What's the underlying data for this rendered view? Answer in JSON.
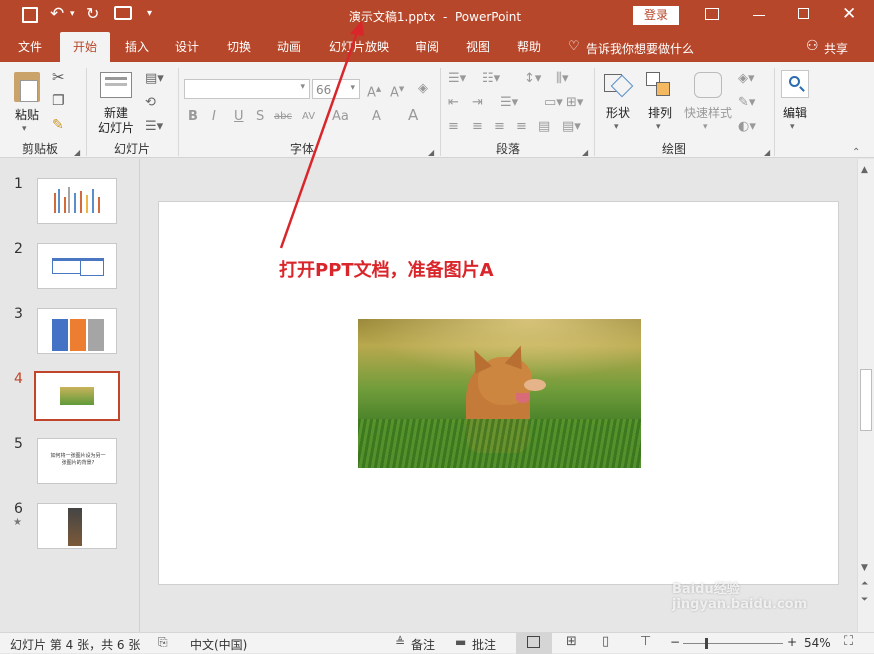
{
  "titlebar": {
    "doc_title": "演示文稿1.pptx  -  PowerPoint",
    "login_button": "登录",
    "quick_access_more": "▾"
  },
  "tabs": [
    {
      "label": "文件"
    },
    {
      "label": "开始"
    },
    {
      "label": "插入"
    },
    {
      "label": "设计"
    },
    {
      "label": "切换"
    },
    {
      "label": "动画"
    },
    {
      "label": "幻灯片放映"
    },
    {
      "label": "审阅"
    },
    {
      "label": "视图"
    },
    {
      "label": "帮助"
    }
  ],
  "tell_me": "告诉我你想要做什么",
  "share": "共享",
  "ribbon": {
    "paste_label": "粘贴",
    "new_slide_label": "新建\n幻灯片",
    "new_slide_line1": "新建",
    "new_slide_line2": "幻灯片",
    "font_size": "66",
    "shape_label": "形状",
    "arrange_label": "排列",
    "quick_style_label": "快速样式",
    "edit_label": "编辑",
    "groups": {
      "clipboard": "剪贴板",
      "slides": "幻灯片",
      "font": "字体",
      "paragraph": "段落",
      "drawing": "绘图"
    },
    "font_buttons": [
      "B",
      "I",
      "U",
      "S",
      "abc",
      "AV",
      "Aa",
      "A",
      "A"
    ]
  },
  "slides": [
    {
      "number": "1"
    },
    {
      "number": "2"
    },
    {
      "number": "3"
    },
    {
      "number": "4"
    },
    {
      "number": "5"
    },
    {
      "number": "6"
    }
  ],
  "slide5_text": "如何将一张图片设为另一张图片的背景?",
  "slide6_star": "★",
  "current_slide": {
    "annotation_text": "打开PPT文档，准备图片A"
  },
  "status": {
    "slide_info": "幻灯片 第 4 张，共 6 张",
    "language": "中文(中国)",
    "notes": "备注",
    "comments": "批注",
    "zoom": "54%",
    "zoom_minus": "−",
    "zoom_plus": "+"
  },
  "colors": {
    "accent": "#b7472a",
    "annotation_red": "#d9262b",
    "selected_thumb_border": "#c0452a"
  },
  "watermark": "Baidu经验 jingyan.baidu.com"
}
